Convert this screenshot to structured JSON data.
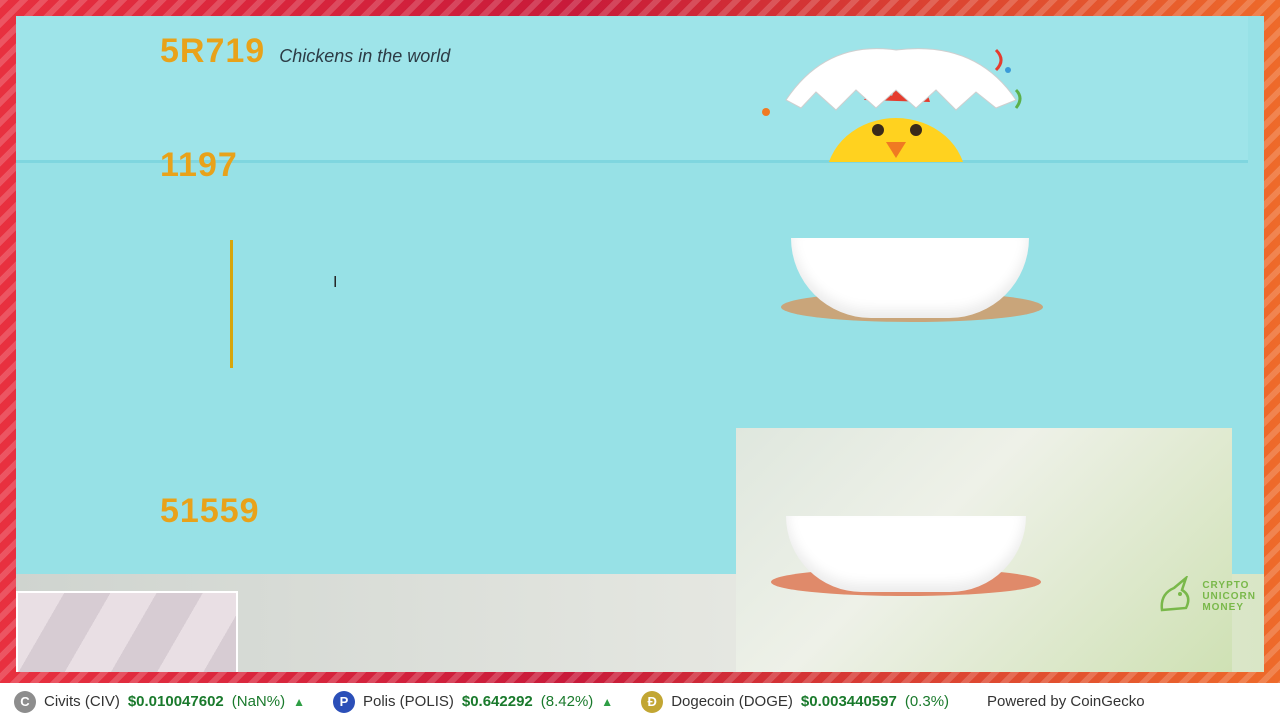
{
  "stats": [
    {
      "value": "5R719",
      "label": "Chickens in the world"
    },
    {
      "value": "1197",
      "label": ""
    },
    {
      "value": "",
      "label": ""
    },
    {
      "value": "51559",
      "label": ""
    }
  ],
  "brand": {
    "line1": "CRYPTO",
    "line2": "UNICORN",
    "line3": "MONEY"
  },
  "ticker": [
    {
      "name": "Civits (CIV)",
      "price": "$0.010047602",
      "change": "(NaN%)",
      "icon": "C",
      "icon_color": "#8d8d8d"
    },
    {
      "name": "Polis (POLIS)",
      "price": "$0.642292",
      "change": "(8.42%)",
      "icon": "P",
      "icon_color": "#2b4fb8"
    },
    {
      "name": "Dogecoin (DOGE)",
      "price": "$0.003440597",
      "change": "(0.3%)",
      "icon": "Ð",
      "icon_color": "#c2a633"
    }
  ],
  "powered_by": "Powered by CoinGecko"
}
